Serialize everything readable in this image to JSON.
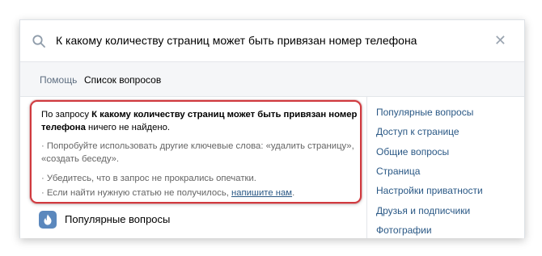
{
  "search": {
    "query": "К какому количеству страниц может быть привязан номер телефона"
  },
  "breadcrumb": {
    "help": "Помощь",
    "questions": "Список вопросов"
  },
  "result": {
    "prefix": "По запросу ",
    "query": "К какому количеству страниц может быть привязан номер телефона",
    "suffix": "ничего не найдено.",
    "tips": [
      {
        "text": "· Попробуйте использовать другие ключевые слова: «удалить страницу», «создать беседу»."
      },
      {
        "text": "· Убедитесь, что в запрос не прокрались опечатки."
      },
      {
        "text_before": "· Если найти нужную статью не получилось, ",
        "link": "напишите нам",
        "text_after": "."
      }
    ]
  },
  "popular": {
    "label": "Популярные вопросы",
    "icon": "flame-icon"
  },
  "sidebar": {
    "items": [
      {
        "label": "Популярные вопросы"
      },
      {
        "label": "Доступ к странице"
      },
      {
        "label": "Общие вопросы"
      },
      {
        "label": "Страница"
      },
      {
        "label": "Настройки приватности"
      },
      {
        "label": "Друзья и подписчики"
      },
      {
        "label": "Фотографии"
      }
    ]
  },
  "colors": {
    "accent_link": "#2a5885",
    "highlight_border": "#d0393e",
    "popular_icon_bg": "#5b88bd"
  }
}
